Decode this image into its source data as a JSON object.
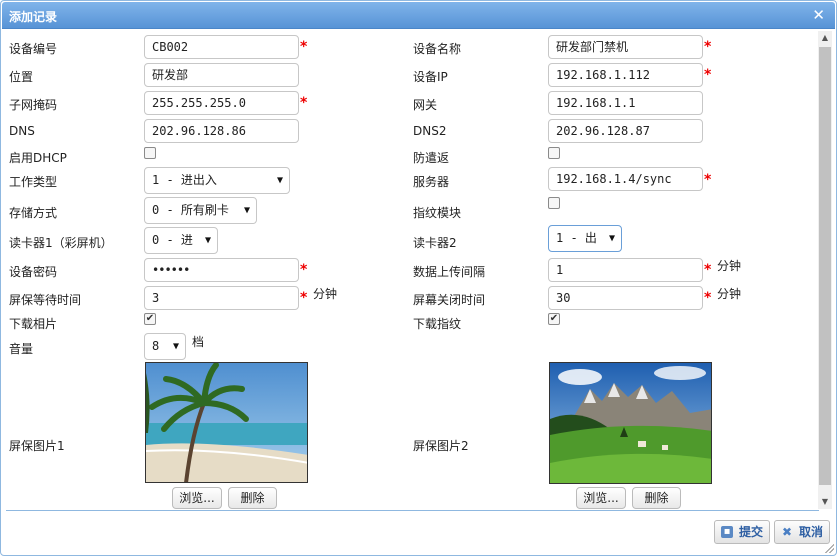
{
  "dialog": {
    "title": "添加记录"
  },
  "left": {
    "device_no": {
      "label": "设备编号",
      "value": "CB002"
    },
    "location": {
      "label": "位置",
      "value": "研发部"
    },
    "subnet": {
      "label": "子网掩码",
      "value": "255.255.255.0"
    },
    "dns": {
      "label": "DNS",
      "value": "202.96.128.86"
    },
    "dhcp": {
      "label": "启用DHCP",
      "checked": false
    },
    "work_type": {
      "label": "工作类型",
      "value": "1 - 进出入"
    },
    "storage": {
      "label": "存储方式",
      "value": "0 - 所有刷卡"
    },
    "reader1": {
      "label": "读卡器1（彩屏机）",
      "value": "0 - 进"
    },
    "password": {
      "label": "设备密码",
      "value": "••••••"
    },
    "screensaver_wait": {
      "label": "屏保等待时间",
      "value": "3",
      "unit": "分钟"
    },
    "download_photo": {
      "label": "下载相片",
      "checked": true
    },
    "volume": {
      "label": "音量",
      "value": "8",
      "unit": "档"
    },
    "pic1": {
      "label": "屏保图片1",
      "browse": "浏览...",
      "delete": "删除"
    }
  },
  "right": {
    "device_name": {
      "label": "设备名称",
      "value": "研发部门禁机"
    },
    "ip": {
      "label": "设备IP",
      "value": "192.168.1.112"
    },
    "gateway": {
      "label": "网关",
      "value": "192.168.1.1"
    },
    "dns2": {
      "label": "DNS2",
      "value": "202.96.128.87"
    },
    "antipassback": {
      "label": "防遣返",
      "checked": false
    },
    "server": {
      "label": "服务器",
      "value": "192.168.1.4/sync"
    },
    "fingerprint": {
      "label": "指纹模块",
      "checked": false
    },
    "reader2": {
      "label": "读卡器2",
      "value": "1 - 出"
    },
    "upload_interval": {
      "label": "数据上传间隔",
      "value": "1",
      "unit": "分钟"
    },
    "screen_off": {
      "label": "屏幕关闭时间",
      "value": "30",
      "unit": "分钟"
    },
    "download_fp": {
      "label": "下载指纹",
      "checked": true
    },
    "pic2": {
      "label": "屏保图片2",
      "browse": "浏览...",
      "delete": "删除"
    }
  },
  "footer": {
    "submit": "提交",
    "cancel": "取消"
  },
  "icons": {
    "close": "close-icon",
    "submit": "save-icon",
    "cancel": "cancel-icon"
  },
  "colors": {
    "titlebar": "#5d97d8",
    "required": "#e00000",
    "button_text": "#2e5fa3"
  }
}
